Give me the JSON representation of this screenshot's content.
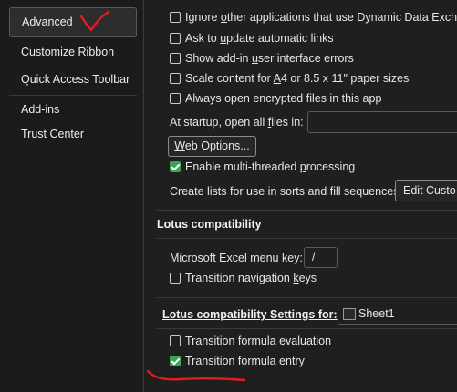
{
  "sidebar": {
    "items": [
      {
        "label": "Advanced",
        "selected": true
      },
      {
        "label": "Customize Ribbon"
      },
      {
        "label": "Quick Access Toolbar"
      },
      {
        "label": "Add-ins"
      },
      {
        "label": "Trust Center"
      }
    ]
  },
  "general": {
    "ignore_dde": {
      "before": "Ignore ",
      "key": "o",
      "after": "ther applications that use Dynamic Data Exchang",
      "checked": false
    },
    "ask_update": {
      "before": "Ask to ",
      "key": "u",
      "after": "pdate automatic links",
      "checked": false
    },
    "show_addin_errors": {
      "before": "Show add-in ",
      "key": "u",
      "after": "ser interface errors",
      "checked": false
    },
    "scale_content": {
      "before": "Scale content for ",
      "key": "A",
      "after": "4 or 8.5 x 11\" paper sizes",
      "checked": false
    },
    "open_encrypted": {
      "label": "Always open encrypted files in this app",
      "checked": false
    },
    "startup_label": {
      "before": "At startup, open all ",
      "key": "f",
      "after": "iles in:"
    },
    "startup_value": "",
    "web_options_label": {
      "key": "W",
      "after": "eb Options..."
    },
    "multithreaded": {
      "before": "Enable multi-threaded ",
      "key": "p",
      "after": "rocessing",
      "checked": true
    },
    "create_lists_label": "Create lists for use in sorts and fill sequences:",
    "edit_custom_label": "Edit Custo"
  },
  "lotus": {
    "title": "Lotus compatibility",
    "menu_key_label": {
      "before": "Microsoft Excel ",
      "key": "m",
      "after": "enu key:"
    },
    "menu_key_value": "/",
    "transition_nav": {
      "before": "Transition navigation ",
      "key": "k",
      "after": "eys",
      "checked": false
    }
  },
  "lotus_settings": {
    "title": "Lotus compatibility Settings for:",
    "sheet_value": "Sheet1",
    "transition_formula_eval": {
      "before": "Transition ",
      "key": "f",
      "after": "ormula evaluation",
      "checked": false
    },
    "transition_formula_entry": {
      "before": "Transition form",
      "key": "u",
      "after": "la entry",
      "checked": true
    }
  },
  "annotations": {
    "color": "#e11d1d"
  }
}
